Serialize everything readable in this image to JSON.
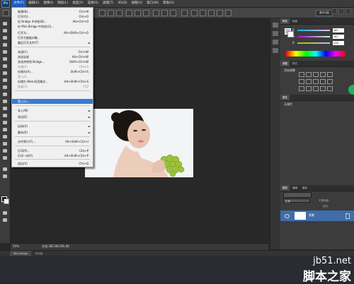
{
  "menubar": {
    "logo": "Ps",
    "items": [
      "文件(F)",
      "编辑(E)",
      "图像(I)",
      "图层(L)",
      "类型(Y)",
      "选择(S)",
      "滤镜(T)",
      "3D(D)",
      "视图(V)",
      "窗口(W)",
      "帮助(H)"
    ]
  },
  "optionsbar": {
    "workspace": "基本功能"
  },
  "file_menu": {
    "items": [
      {
        "label": "新建(N)...",
        "shortcut": "Ctrl+N"
      },
      {
        "label": "打开(O)...",
        "shortcut": "Ctrl+O"
      },
      {
        "label": "在 Bridge 中浏览(B)...",
        "shortcut": "Alt+Ctrl+O"
      },
      {
        "label": "在 Mini Bridge 中浏览(G)...",
        "shortcut": ""
      },
      {
        "label": "打开为...",
        "shortcut": "Alt+Shift+Ctrl+O"
      },
      {
        "label": "打开为智能对象...",
        "shortcut": ""
      },
      {
        "label": "最近打开文件(T)",
        "shortcut": ""
      },
      {
        "label": "关闭(C)",
        "shortcut": "Ctrl+W"
      },
      {
        "label": "关闭全部",
        "shortcut": "Alt+Ctrl+W"
      },
      {
        "label": "关闭并转到 Bridge...",
        "shortcut": "Shift+Ctrl+W"
      },
      {
        "label": "存储(S)",
        "shortcut": "Ctrl+S"
      },
      {
        "label": "存储为(A)...",
        "shortcut": "Shift+Ctrl+S"
      },
      {
        "label": "签入(I)...",
        "shortcut": ""
      },
      {
        "label": "存储为 Web 所用格式...",
        "shortcut": "Alt+Shift+Ctrl+S"
      },
      {
        "label": "恢复(V)",
        "shortcut": "F12"
      },
      {
        "label": "置入(L)...",
        "shortcut": ""
      },
      {
        "label": "导入(M)",
        "shortcut": ""
      },
      {
        "label": "导出(E)",
        "shortcut": ""
      },
      {
        "label": "自动(U)",
        "shortcut": ""
      },
      {
        "label": "脚本(R)",
        "shortcut": ""
      },
      {
        "label": "文件简介(F)...",
        "shortcut": "Alt+Shift+Ctrl+I"
      },
      {
        "label": "打印(P)...",
        "shortcut": "Ctrl+P"
      },
      {
        "label": "打印一份(Y)",
        "shortcut": "Alt+Shift+Ctrl+P"
      },
      {
        "label": "退出(X)",
        "shortcut": "Ctrl+Q"
      }
    ]
  },
  "status": {
    "zoom": "50%",
    "doc": "文档:385.8K/385.8K"
  },
  "minibridge": {
    "tab1": "Mini Bridge",
    "tab2": "时间轴"
  },
  "panels": {
    "color_tabs": [
      "颜色",
      "色板"
    ],
    "color_values": {
      "r": "181",
      "g": "187",
      "b": "228"
    },
    "color_labels": {
      "r": "R",
      "g": "G",
      "b": "B"
    },
    "adjust_tabs": [
      "调整",
      "样式"
    ],
    "adjust_title": "添加调整",
    "props_tabs": [
      "属性"
    ],
    "props_text": "无属性",
    "layer_tabs": [
      "图层",
      "通道",
      "路径"
    ],
    "layer_mode": "正常",
    "layer_opacity_label": "不透明度:",
    "layer_fill_label": "填充:",
    "layer_name": "背景"
  },
  "watermark": {
    "url": "jb51.net",
    "text": "脚本之家"
  },
  "colors": {
    "accent": "#3a7bd5",
    "menu_bg": "#f0f0f0",
    "ui_dark": "#3c3c3c"
  }
}
